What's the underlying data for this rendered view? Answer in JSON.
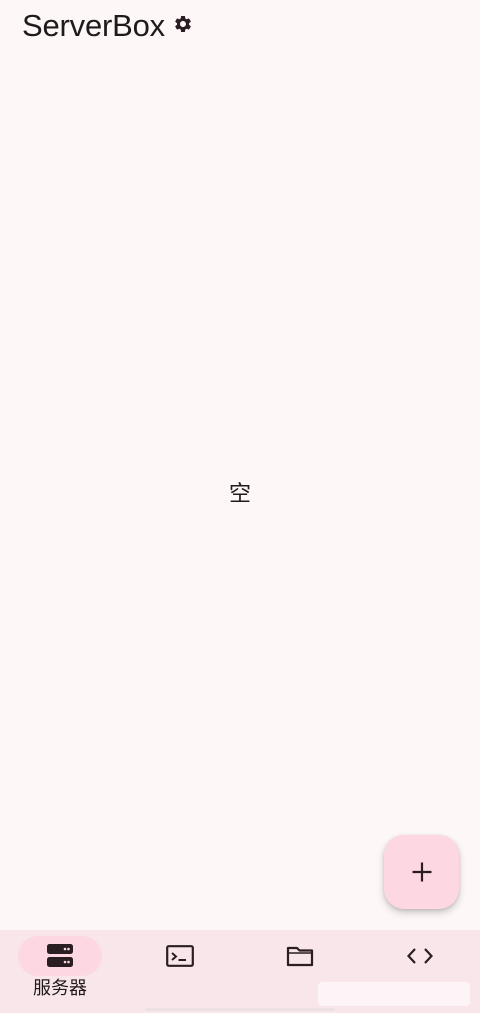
{
  "app": {
    "title": "ServerBox"
  },
  "icons": {
    "settings": "gear-icon",
    "add": "plus-icon",
    "servers": "server-icon",
    "terminal": "terminal-icon",
    "files": "folder-icon",
    "snippets": "code-icon"
  },
  "main": {
    "empty_text": "空"
  },
  "bottom_nav": {
    "items": [
      {
        "id": "servers",
        "label": "服务器",
        "active": true
      },
      {
        "id": "terminal",
        "label": "",
        "active": false
      },
      {
        "id": "files",
        "label": "",
        "active": false
      },
      {
        "id": "snippets",
        "label": "",
        "active": false
      }
    ]
  },
  "colors": {
    "background": "#fdf7f7",
    "fab": "#fdd8e2",
    "nav_background": "#f8e6ea",
    "nav_active_indicator": "#fdd8e2",
    "icon": "#2a1e22"
  }
}
